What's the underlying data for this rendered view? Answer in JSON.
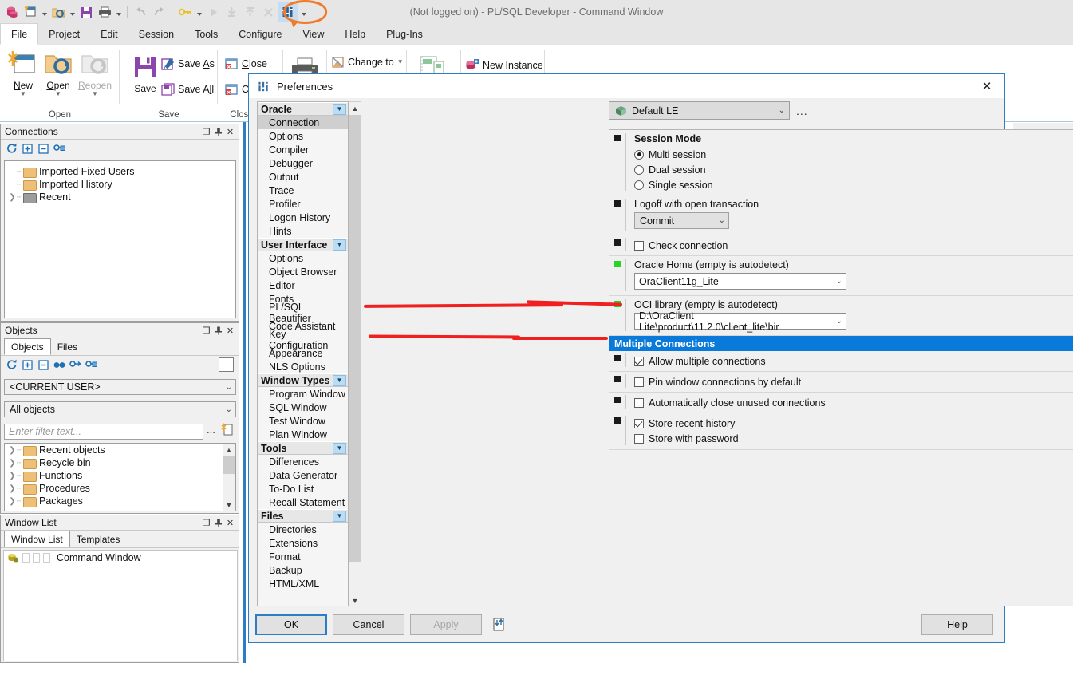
{
  "window": {
    "title": "(Not logged on) - PL/SQL Developer - Command Window"
  },
  "quick_access": {
    "items": [
      {
        "name": "database-icon",
        "glyph": "☲"
      },
      {
        "name": "new-document-icon",
        "glyph": "⬜"
      },
      {
        "name": "open-folder-icon",
        "glyph": "📁"
      },
      {
        "name": "save-icon",
        "glyph": "💾"
      },
      {
        "name": "print-icon",
        "glyph": "🖨"
      },
      {
        "name": "undo-icon",
        "glyph": "↶"
      },
      {
        "name": "redo-icon",
        "glyph": "↷"
      },
      {
        "name": "key-icon",
        "glyph": "🔑"
      },
      {
        "name": "execute-icon",
        "glyph": "▶"
      },
      {
        "name": "step-into-icon",
        "glyph": "⇩"
      },
      {
        "name": "step-out-icon",
        "glyph": "⇧"
      },
      {
        "name": "break-icon",
        "glyph": "✕"
      },
      {
        "name": "preferences-icon",
        "glyph": "☰"
      }
    ]
  },
  "menu": {
    "tabs": [
      {
        "label": "File",
        "active": true
      },
      {
        "label": "Project",
        "active": false
      },
      {
        "label": "Edit",
        "active": false
      },
      {
        "label": "Session",
        "active": false
      },
      {
        "label": "Tools",
        "active": false
      },
      {
        "label": "Configure",
        "active": false
      },
      {
        "label": "View",
        "active": false
      },
      {
        "label": "Help",
        "active": false
      },
      {
        "label": "Plug-Ins",
        "active": false
      }
    ]
  },
  "ribbon": {
    "groups": [
      {
        "label": "Open"
      },
      {
        "label": "Save"
      },
      {
        "label": "Close"
      }
    ],
    "new_label": "New",
    "open_label": "Open",
    "reopen_label": "Reopen",
    "save_label": "Save",
    "save_as_label": "Save As",
    "save_all_label": "Save All",
    "close_label": "Close",
    "close_all_label": "Close All",
    "change_to_label": "Change to",
    "new_instance_label": "New Instance"
  },
  "connections_panel": {
    "title": "Connections",
    "nodes": [
      {
        "label": "Imported Fixed Users",
        "expandable": false,
        "color": "orange"
      },
      {
        "label": "Imported History",
        "expandable": false,
        "color": "orange"
      },
      {
        "label": "Recent",
        "expandable": true,
        "color": "grey"
      }
    ]
  },
  "objects_panel": {
    "title": "Objects",
    "tabs": [
      {
        "label": "Objects",
        "active": true
      },
      {
        "label": "Files",
        "active": false
      }
    ],
    "user_filter": "<CURRENT USER>",
    "object_filter": "All objects",
    "filter_placeholder": "Enter filter text...",
    "ellipsis_label": "...",
    "nodes": [
      {
        "label": "Recent objects"
      },
      {
        "label": "Recycle bin"
      },
      {
        "label": "Functions"
      },
      {
        "label": "Procedures"
      },
      {
        "label": "Packages"
      }
    ]
  },
  "window_list_panel": {
    "title": "Window List",
    "tabs": [
      {
        "label": "Window List",
        "active": true
      },
      {
        "label": "Templates",
        "active": false
      }
    ],
    "items": [
      {
        "label": "Command Window"
      }
    ]
  },
  "preferences_dialog": {
    "title": "Preferences",
    "close_label": "✕",
    "profile": "Default LE",
    "profile_ellipsis": "...",
    "tree": [
      {
        "type": "group",
        "label": "Oracle"
      },
      {
        "type": "leaf",
        "label": "Connection",
        "selected": true
      },
      {
        "type": "leaf",
        "label": "Options"
      },
      {
        "type": "leaf",
        "label": "Compiler"
      },
      {
        "type": "leaf",
        "label": "Debugger"
      },
      {
        "type": "leaf",
        "label": "Output"
      },
      {
        "type": "leaf",
        "label": "Trace"
      },
      {
        "type": "leaf",
        "label": "Profiler"
      },
      {
        "type": "leaf",
        "label": "Logon History"
      },
      {
        "type": "leaf",
        "label": "Hints"
      },
      {
        "type": "group",
        "label": "User Interface"
      },
      {
        "type": "leaf",
        "label": "Options"
      },
      {
        "type": "leaf",
        "label": "Object Browser"
      },
      {
        "type": "leaf",
        "label": "Editor"
      },
      {
        "type": "leaf",
        "label": "Fonts"
      },
      {
        "type": "leaf",
        "label": "PL/SQL Beautifier"
      },
      {
        "type": "leaf",
        "label": "Code Assistant"
      },
      {
        "type": "leaf",
        "label": "Key Configuration"
      },
      {
        "type": "leaf",
        "label": "Appearance"
      },
      {
        "type": "leaf",
        "label": "NLS Options"
      },
      {
        "type": "group",
        "label": "Window Types"
      },
      {
        "type": "leaf",
        "label": "Program Window"
      },
      {
        "type": "leaf",
        "label": "SQL Window"
      },
      {
        "type": "leaf",
        "label": "Test Window"
      },
      {
        "type": "leaf",
        "label": "Plan Window"
      },
      {
        "type": "group",
        "label": "Tools"
      },
      {
        "type": "leaf",
        "label": "Differences"
      },
      {
        "type": "leaf",
        "label": "Data Generator"
      },
      {
        "type": "leaf",
        "label": "To-Do List"
      },
      {
        "type": "leaf",
        "label": "Recall Statement"
      },
      {
        "type": "group",
        "label": "Files"
      },
      {
        "type": "leaf",
        "label": "Directories"
      },
      {
        "type": "leaf",
        "label": "Extensions"
      },
      {
        "type": "leaf",
        "label": "Format"
      },
      {
        "type": "leaf",
        "label": "Backup"
      },
      {
        "type": "leaf",
        "label": "HTML/XML"
      }
    ],
    "settings": {
      "session_mode_label": "Session Mode",
      "session_modes": [
        {
          "label": "Multi session",
          "selected": true
        },
        {
          "label": "Dual session",
          "selected": false
        },
        {
          "label": "Single session",
          "selected": false
        }
      ],
      "logoff_label": "Logoff with open transaction",
      "logoff_value": "Commit",
      "check_connection_label": "Check connection",
      "check_connection_checked": false,
      "oracle_home_label": "Oracle Home (empty is autodetect)",
      "oracle_home_value": "OraClient11g_Lite",
      "oci_library_label": "OCI library (empty is autodetect)",
      "oci_library_value": "D:\\OraClient Lite\\product\\11.2.0\\client_lite\\bir",
      "multiple_connections_label": "Multiple Connections",
      "allow_multiple_label": "Allow multiple connections",
      "allow_multiple_checked": true,
      "pin_window_label": "Pin window connections by default",
      "pin_window_checked": false,
      "auto_close_label": "Automatically close unused connections",
      "auto_close_checked": false,
      "store_recent_label": "Store recent history",
      "store_recent_checked": true,
      "store_password_label": "Store with password",
      "store_password_checked": false
    },
    "buttons": {
      "ok": "OK",
      "cancel": "Cancel",
      "apply": "Apply",
      "help": "Help"
    }
  },
  "colors": {
    "accent": "#2e7cc4",
    "section_header": "#0a7ada",
    "annotation_red": "#f02020",
    "highlight_orange": "#f07a28",
    "modified_green": "#25d425"
  }
}
